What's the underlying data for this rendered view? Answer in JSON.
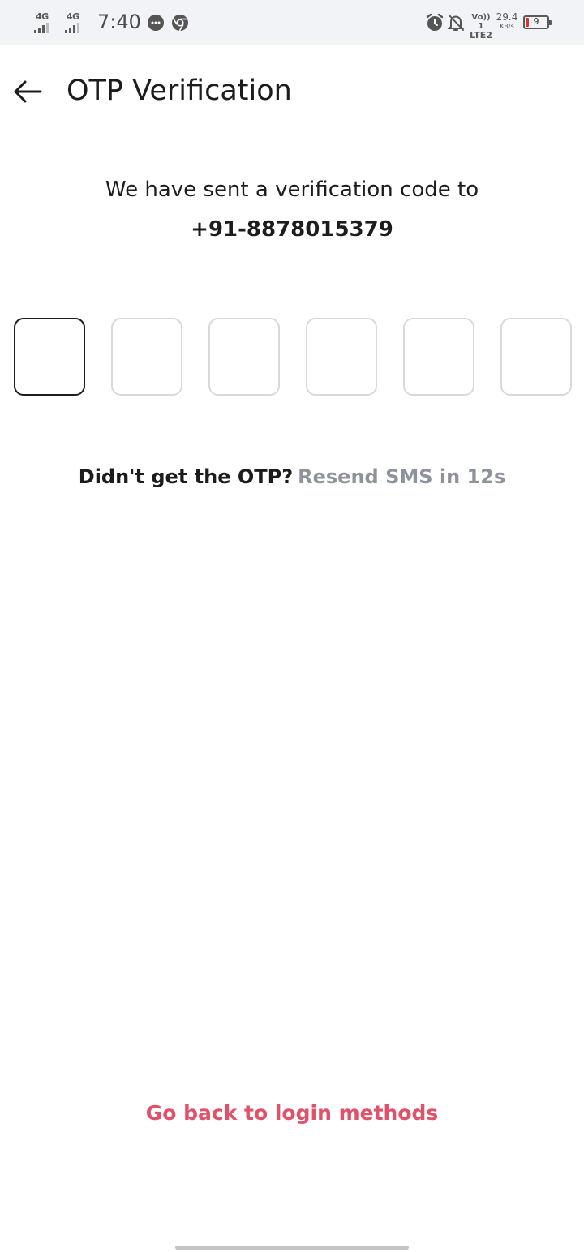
{
  "status_bar": {
    "sim1_network": "4G",
    "sim2_network": "4G",
    "time": "7:40",
    "volte_line1": "Vo)) 1",
    "volte_line2": "LTE2",
    "speed_value": "29.4",
    "speed_unit": "KB/s",
    "battery_level": "9",
    "battery_color": "#e0302b",
    "icons": [
      "signal-icon",
      "signal-icon",
      "message-notification-icon",
      "chrome-icon",
      "alarm-icon",
      "notifications-off-icon",
      "battery-icon"
    ]
  },
  "header": {
    "title": "OTP Verification",
    "back_icon": "back-arrow-icon"
  },
  "message": {
    "text": "We have sent a verification code to",
    "phone": "+91-8878015379"
  },
  "otp": {
    "length": 6,
    "values": [
      "",
      "",
      "",
      "",
      "",
      ""
    ],
    "active_index": 0
  },
  "resend": {
    "question": "Didn't get the OTP?",
    "timer_text": "Resend SMS in 12s"
  },
  "footer": {
    "go_back_label": "Go back to login methods",
    "link_color": "#e0526a"
  }
}
